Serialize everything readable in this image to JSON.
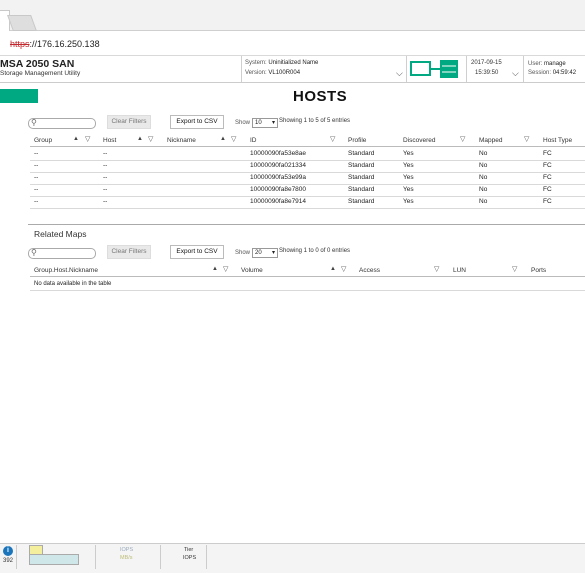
{
  "browser": {
    "url_proto": "https",
    "url_rest": "://176.16.250.138"
  },
  "header": {
    "product": "MSA 2050 SAN",
    "product_sub": "Storage Management Utility",
    "system_label": "System:",
    "system_value": "Uninitialized Name",
    "version_label": "Version:",
    "version_value": "VL100R004",
    "date": "2017-09-15",
    "time": "15:39:50",
    "user_label": "User:",
    "user_value": "manage",
    "session_label": "Session:",
    "session_value": "04:59:42"
  },
  "page": {
    "title": "HOSTS"
  },
  "hosts": {
    "clear_filters": "Clear Filters",
    "export_csv": "Export to CSV",
    "show_label": "Show",
    "page_size": "10",
    "entries_info": "Showing 1 to 5 of 5 entries",
    "columns": [
      "Group",
      "Host",
      "Nickname",
      "ID",
      "Profile",
      "Discovered",
      "Mapped",
      "Host Type"
    ],
    "rows": [
      [
        "--",
        "--",
        "",
        "10000090fa53e8ae",
        "Standard",
        "Yes",
        "No",
        "FC"
      ],
      [
        "--",
        "--",
        "",
        "10000090fa021334",
        "Standard",
        "Yes",
        "No",
        "FC"
      ],
      [
        "--",
        "--",
        "",
        "10000090fa53e99a",
        "Standard",
        "Yes",
        "No",
        "FC"
      ],
      [
        "--",
        "--",
        "",
        "10000090fa8e7800",
        "Standard",
        "Yes",
        "No",
        "FC"
      ],
      [
        "--",
        "--",
        "",
        "10000090fa8e7914",
        "Standard",
        "Yes",
        "No",
        "FC"
      ]
    ]
  },
  "maps": {
    "title": "Related Maps",
    "clear_filters": "Clear Filters",
    "export_csv": "Export to CSV",
    "show_label": "Show",
    "page_size": "20",
    "entries_info": "Showing 1 to 0 of 0 entries",
    "columns": [
      "Group.Host.Nickname",
      "Volume",
      "Access",
      "LUN",
      "Ports"
    ],
    "empty_text": "No data available in the table"
  },
  "footer": {
    "count": "392",
    "iops_label": "IOPS",
    "mbs_label": "MB/s",
    "tier_label": "Tier",
    "tier_iops": "IOPS"
  },
  "colors": {
    "accent": "#01a982",
    "info": "#1b75bc"
  }
}
